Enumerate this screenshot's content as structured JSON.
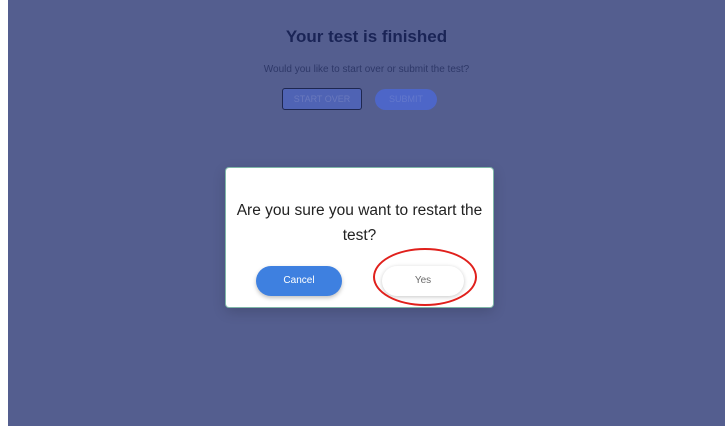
{
  "page": {
    "title": "Your test is finished",
    "subtitle": "Would you like to start over or submit the test?",
    "start_over_label": "START OVER",
    "submit_label": "SUBMIT"
  },
  "modal": {
    "message": "Are you sure you want to restart the test?",
    "cancel_label": "Cancel",
    "yes_label": "Yes"
  },
  "colors": {
    "backdrop": "#545e8f",
    "primary_button": "#3e80e0",
    "highlight_ring": "#e0201c"
  }
}
